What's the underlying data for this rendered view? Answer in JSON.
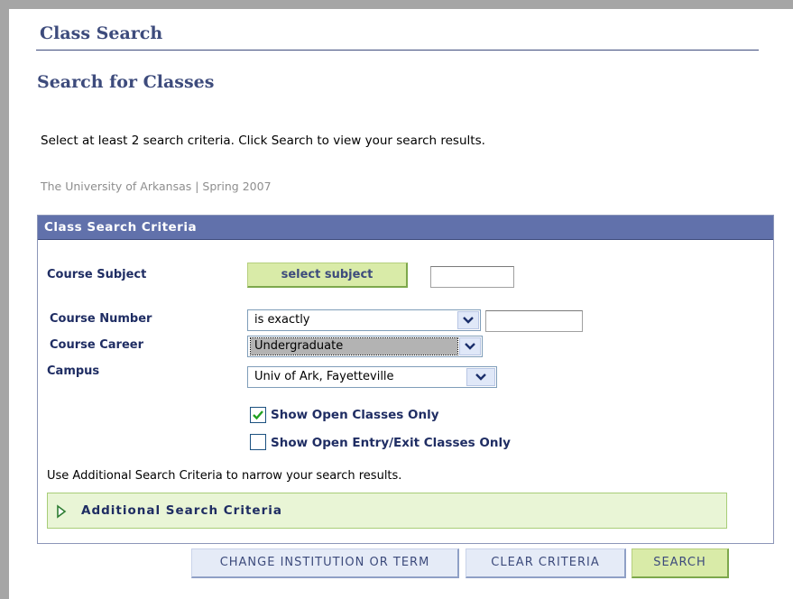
{
  "header": {
    "title": "Class Search"
  },
  "page": {
    "title": "Search for Classes",
    "instructions": "Select at least 2 search criteria. Click Search to view your search results.",
    "term_info": "The University of Arkansas | Spring 2007"
  },
  "criteria": {
    "section_title": "Class Search Criteria",
    "subject": {
      "label": "Course Subject",
      "button_label": "select subject",
      "value": ""
    },
    "course_number": {
      "label": "Course Number",
      "operator": "is exactly",
      "value": ""
    },
    "course_career": {
      "label": "Course Career",
      "value": "Undergraduate"
    },
    "campus": {
      "label": "Campus",
      "value": "Univ of Ark, Fayetteville"
    },
    "open_only": {
      "label": "Show Open Classes Only",
      "checked": true
    },
    "open_entry_exit": {
      "label": "Show Open Entry/Exit Classes Only",
      "checked": false
    },
    "additional_note": "Use Additional Search Criteria to narrow your search results.",
    "additional_label": "Additional Search Criteria"
  },
  "buttons": {
    "change": "CHANGE INSTITUTION OR TERM",
    "clear": "CLEAR CRITERIA",
    "search": "SEARCH"
  },
  "icons": [
    "chevron-down-icon",
    "checkmark-icon",
    "expand-triangle-icon"
  ],
  "colors": {
    "header_bar": "#6171ab",
    "title_text": "#3d4b7c",
    "green_button": "#d9eba8",
    "blue_button": "#e5ebf7"
  }
}
